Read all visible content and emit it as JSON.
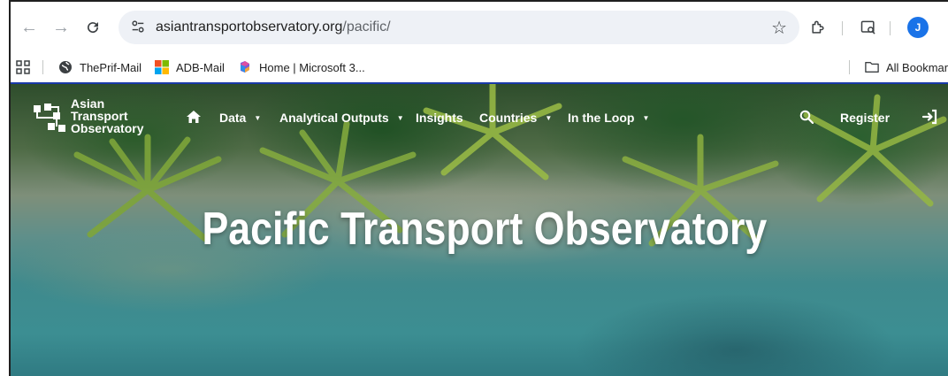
{
  "browser": {
    "url_host": "asiantransportobservatory.org",
    "url_path": "/pacific/",
    "profile_initial": "J",
    "icons": [
      "back-icon",
      "forward-icon",
      "reload-icon",
      "site-info-icon",
      "star-icon",
      "extensions-icon",
      "tab-search-icon"
    ]
  },
  "bookmarks": {
    "items": [
      {
        "label": "ThePrif-Mail",
        "icon": "globe-icon"
      },
      {
        "label": "ADB-Mail",
        "icon": "microsoft-icon"
      },
      {
        "label": "Home | Microsoft 3...",
        "icon": "m365-icon"
      }
    ],
    "all_label": "All Bookmar"
  },
  "site": {
    "logo_lines": [
      "Asian",
      "Transport",
      "Observatory"
    ],
    "nav": [
      {
        "label": "Data",
        "dropdown": true
      },
      {
        "label": "Analytical Outputs",
        "dropdown": true
      },
      {
        "label": "Insights",
        "dropdown": false
      },
      {
        "label": "Countries",
        "dropdown": true
      },
      {
        "label": "In the Loop",
        "dropdown": true
      }
    ],
    "register_label": "Register",
    "hero_title": "Pacific Transport Observatory"
  },
  "colors": {
    "accent_blue": "#1a73e8",
    "page_border": "#1a3aa8",
    "foliage": "#2e4d2c",
    "water": "#3c8e92"
  }
}
